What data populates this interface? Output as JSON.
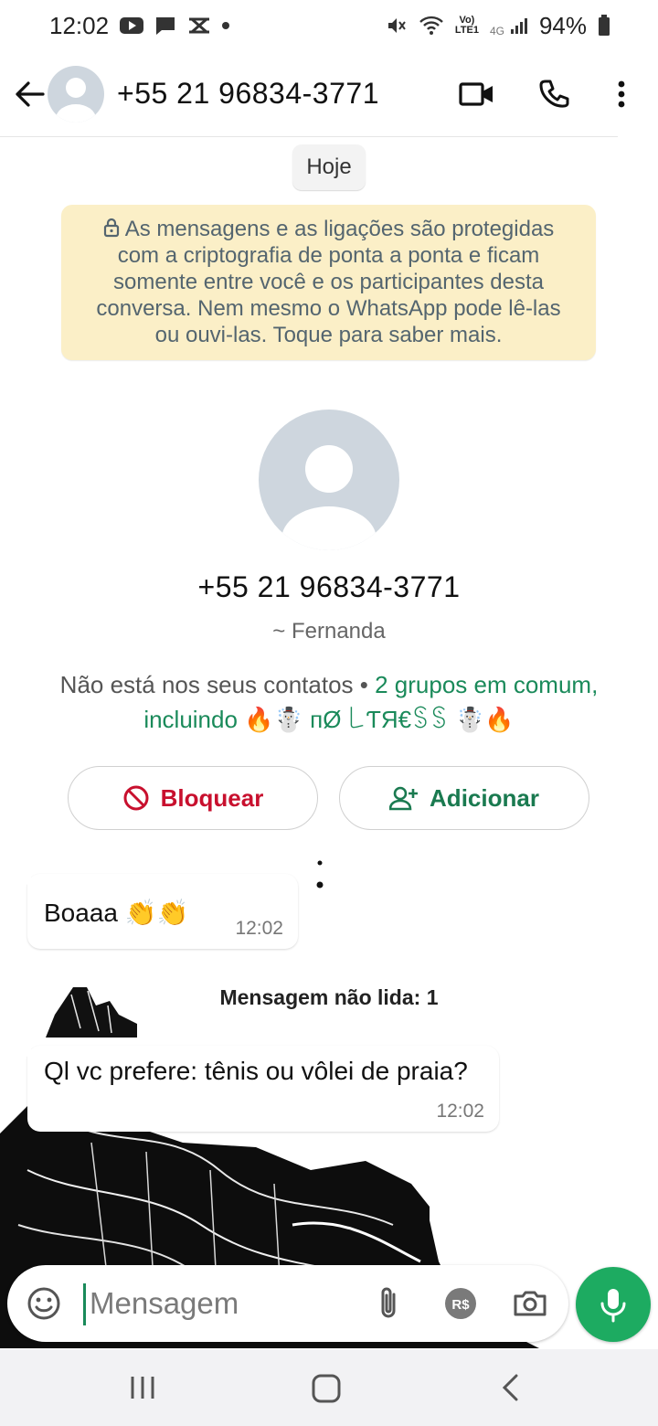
{
  "status_bar": {
    "time": "12:02",
    "battery": "94%",
    "network_top": "Vo)",
    "network_bottom": "LTE1",
    "network_gen": "4G"
  },
  "header": {
    "title": "+55 21 96834-3771"
  },
  "chat": {
    "date_chip": "Hoje",
    "encryption_notice": "As mensagens e as ligações são protegidas com a criptografia de ponta a ponta e ficam somente entre você e os participantes desta conversa. Nem mesmo o WhatsApp pode lê-las ou ouvi-las. Toque para saber mais.",
    "profile": {
      "number": "+55 21 96834-3771",
      "name": "~ Fernanda",
      "not_in_contacts": "Não está nos seus contatos • ",
      "groups_common": "2 grupos em comum, incluindo 🔥☃️ пØ ꒒ƬЯ€ꌗꌗ ☃️🔥"
    },
    "actions": {
      "block_label": "Bloquear",
      "add_label": "Adicionar"
    },
    "messages": [
      {
        "text": "Boaaa 👏👏",
        "time": "12:02"
      },
      {
        "text": "Ql vc prefere: tênis ou vôlei de praia?",
        "time": "12:02"
      }
    ],
    "unread_label": "Mensagem não lida: 1"
  },
  "composer": {
    "placeholder": "Mensagem",
    "pay_label": "R$"
  },
  "colors": {
    "accent_green": "#1dab61",
    "encryption_bg": "#fbefc7",
    "block_red": "#c8102e"
  }
}
